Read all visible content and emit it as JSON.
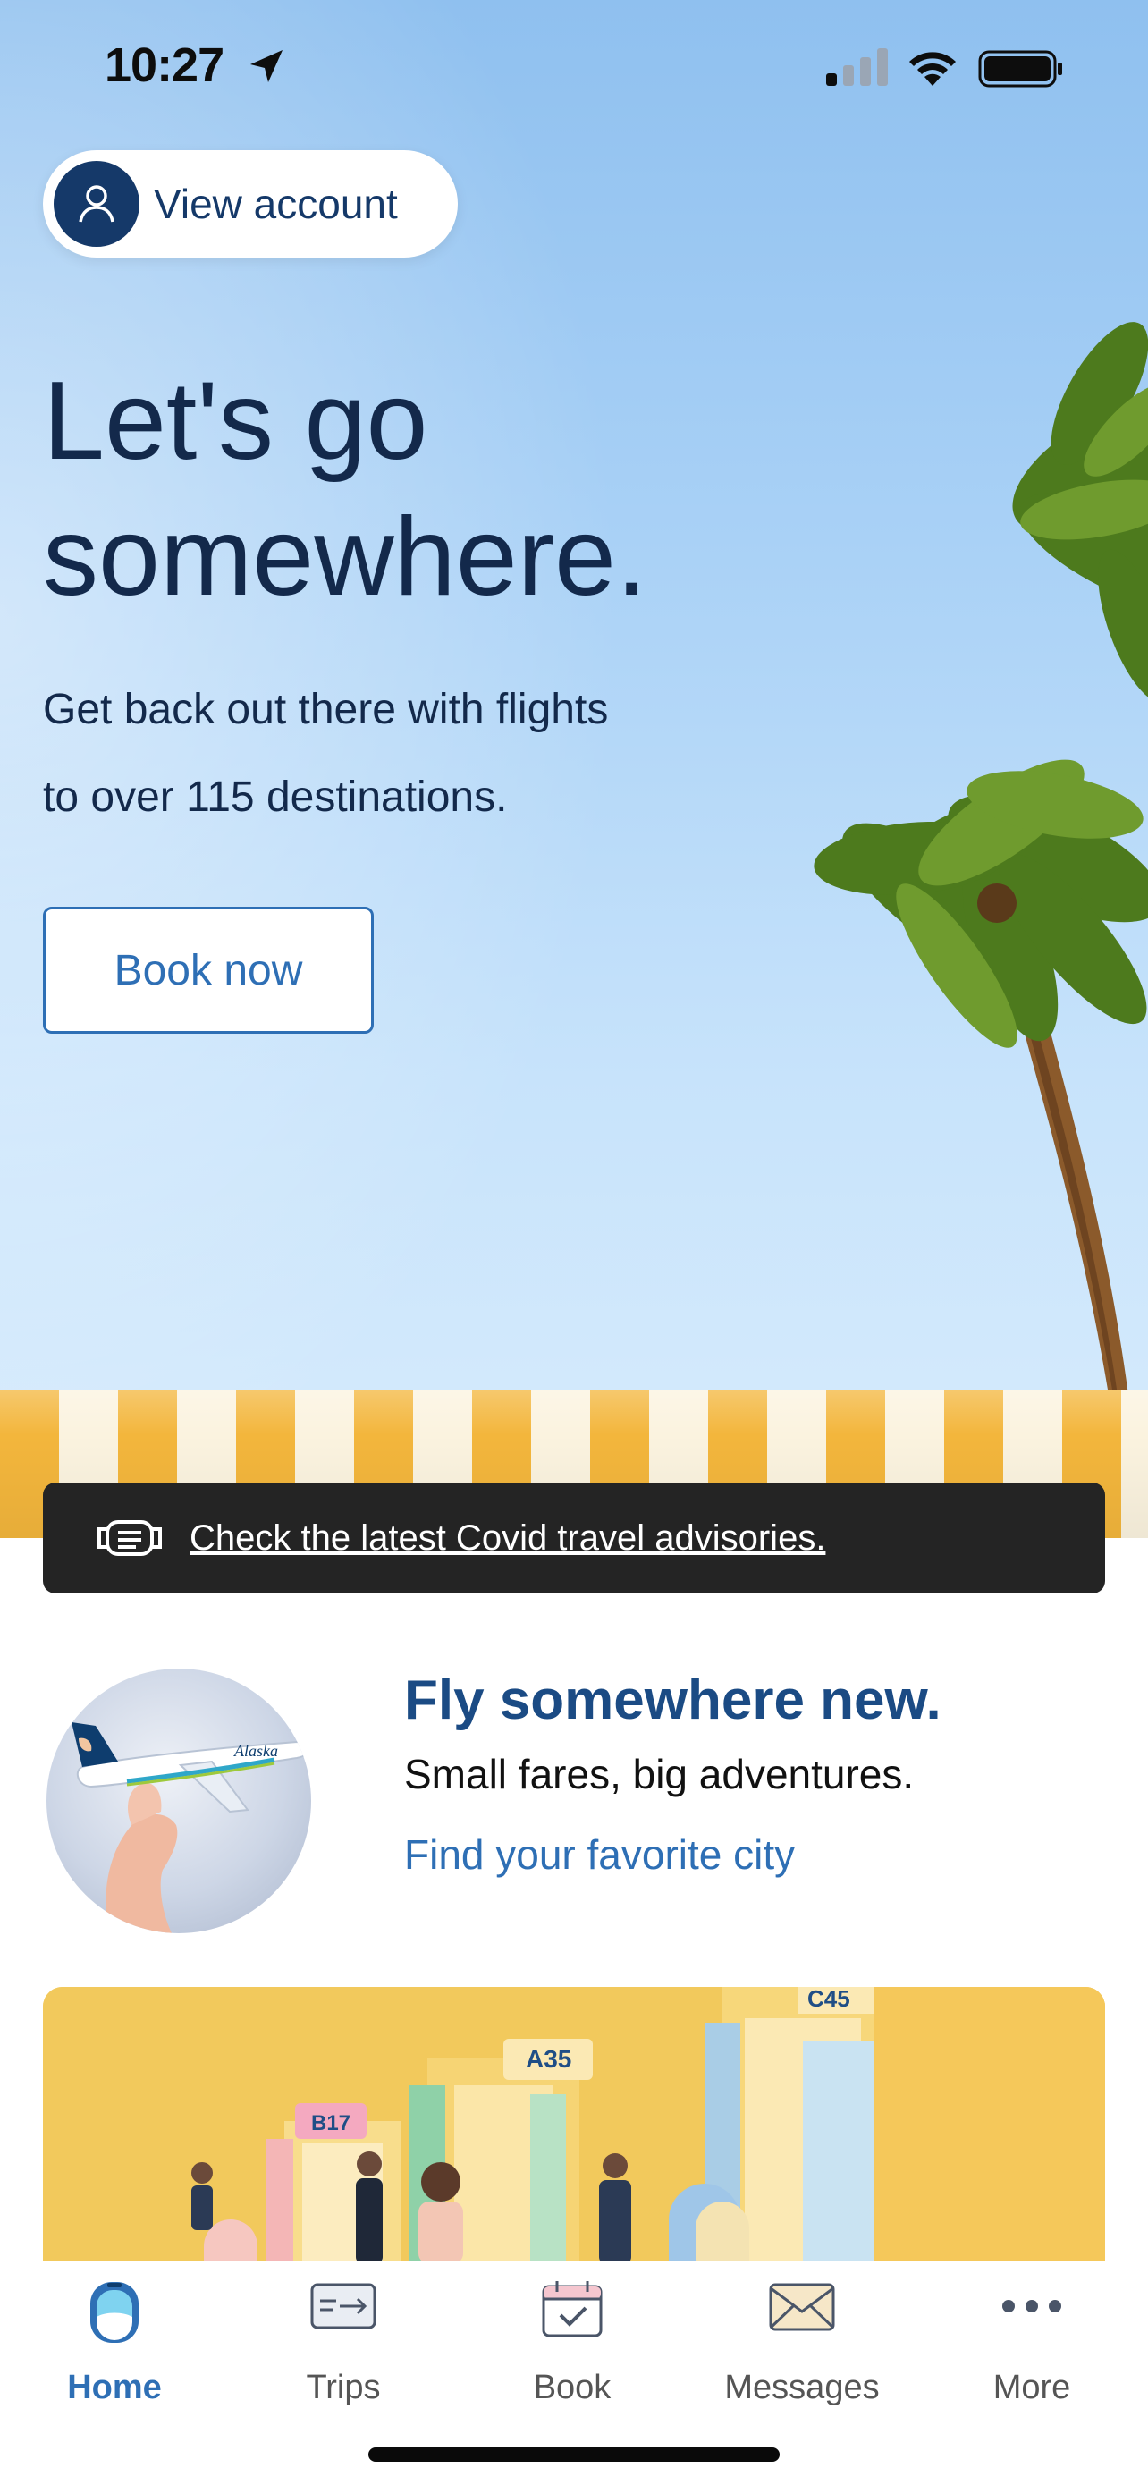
{
  "status_bar": {
    "time": "10:27",
    "icons": [
      "location-arrow-icon",
      "cellular-signal-icon",
      "wifi-icon",
      "battery-icon"
    ]
  },
  "account": {
    "label": "View account",
    "icon": "person-icon"
  },
  "hero": {
    "headline_line1": "Let's go",
    "headline_line2": "somewhere.",
    "subtext_line1": "Get back out there with flights",
    "subtext_line2": "to over 115 destinations.",
    "cta": "Book now"
  },
  "advisory": {
    "text": "Check the latest Covid travel advisories.",
    "icon": "mask-icon"
  },
  "promo": {
    "title": "Fly somewhere new.",
    "subtitle": "Small fares, big adventures.",
    "link": "Find your favorite city",
    "image_text": "Alaska"
  },
  "banner": {
    "gates": [
      "B17",
      "A35",
      "C45"
    ]
  },
  "tabs": [
    {
      "label": "Home",
      "icon": "home-window-icon",
      "active": true
    },
    {
      "label": "Trips",
      "icon": "boarding-pass-icon",
      "active": false
    },
    {
      "label": "Book",
      "icon": "calendar-check-icon",
      "active": false
    },
    {
      "label": "Messages",
      "icon": "envelope-icon",
      "active": false
    },
    {
      "label": "More",
      "icon": "more-dots-icon",
      "active": false
    }
  ],
  "colors": {
    "navy": "#13294b",
    "brand_blue": "#2e6fb5",
    "dark_bar": "#242424",
    "awning_yellow": "#f3b63c"
  }
}
